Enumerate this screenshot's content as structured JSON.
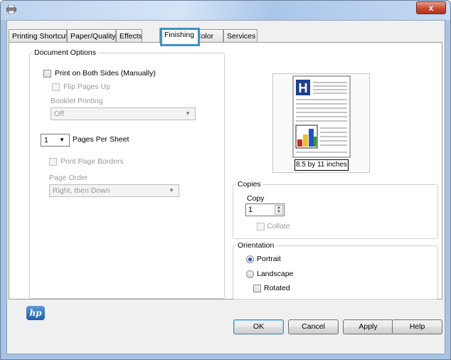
{
  "window": {
    "close_glyph": "x",
    "app_icon": "printer-icon"
  },
  "tabs": [
    {
      "label": "Printing Shortcuts",
      "active": false
    },
    {
      "label": "Paper/Quality",
      "active": false
    },
    {
      "label": "Effects",
      "active": false
    },
    {
      "label": "Finishing",
      "active": true
    },
    {
      "label": "Color",
      "active": false
    },
    {
      "label": "Services",
      "active": false
    }
  ],
  "document_options": {
    "legend": "Document Options",
    "print_both_sides": "Print on Both Sides (Manually)",
    "flip_pages_up": "Flip Pages Up",
    "booklet_printing_label": "Booklet Printing",
    "booklet_printing_value": "Off",
    "pages_per_sheet_value": "1",
    "pages_per_sheet_label": "Pages Per Sheet",
    "print_page_borders": "Print Page Borders",
    "page_order_label": "Page Order",
    "page_order_value": "Right, then Down"
  },
  "preview": {
    "size_label": "8.5 by 11 inches"
  },
  "copies": {
    "legend": "Copies",
    "copy_label": "Copy",
    "copy_value": "1",
    "collate": "Collate"
  },
  "orientation": {
    "legend": "Orientation",
    "portrait": "Portrait",
    "landscape": "Landscape",
    "rotated": "Rotated",
    "selected": "Portrait"
  },
  "buttons": {
    "ok": "OK",
    "cancel": "Cancel",
    "apply": "Apply",
    "help": "Help"
  },
  "logo": {
    "text": "hp"
  },
  "colors": {
    "highlight": "#3b94c6",
    "accent": "#1b57c4"
  }
}
